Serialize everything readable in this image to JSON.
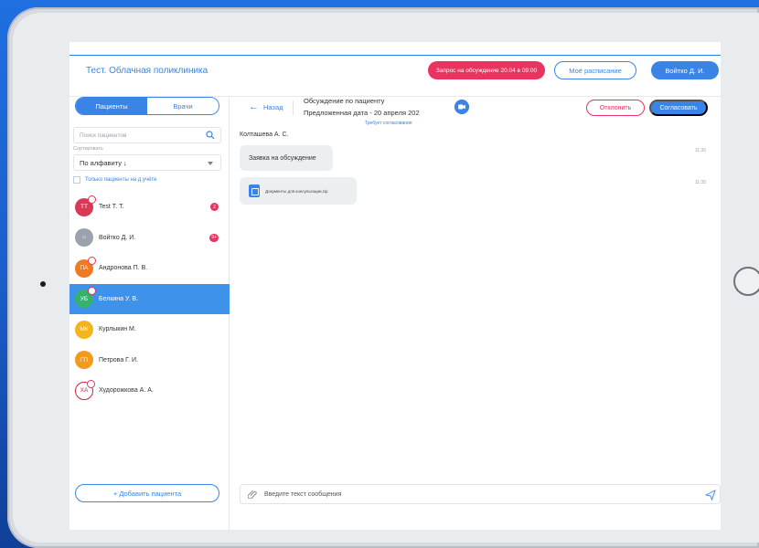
{
  "app": {
    "title": "Тест. Облачная поликлиника",
    "header": {
      "request_button": "Запрос на обсуждение 20.04 в 09:00",
      "schedule_button": "Моё расписание",
      "user_button": "Войтко Д. И."
    }
  },
  "sidebar": {
    "tabs": [
      "Пациенты",
      "Врачи"
    ],
    "search_placeholder": "Поиск пациентов",
    "sort_label": "Сортировать",
    "sort_value": "По алфавиту ↓",
    "only_mine_label": "Только пациенты на д.учёте",
    "patients": [
      {
        "initials": "ТТ",
        "name": "Test Т. Т.",
        "badge": "2",
        "color": "#d83a55"
      },
      {
        "initials": "",
        "name": "Войтко Д. И.",
        "badge": "9+",
        "color": "#9aa2ad"
      },
      {
        "initials": "ПА",
        "name": "Андронова П. В.",
        "badge": "",
        "color": "#f07a22"
      },
      {
        "initials": "УБ",
        "name": "Белкина У. В.",
        "badge": "",
        "color": "#33b36b"
      },
      {
        "initials": "МК",
        "name": "Курлыкин М.",
        "badge": "",
        "color": "#f5b41e"
      },
      {
        "initials": "ГП",
        "name": "Петрова Г. И.",
        "badge": "",
        "color": "#f39a1c"
      },
      {
        "initials": "ХА",
        "name": "Худорожкова А. А.",
        "badge": "",
        "color": "#c9283a"
      }
    ],
    "add_patient": "+ Добавить пациента"
  },
  "chat": {
    "back": "Назад",
    "topic": "Обсуждение по пациенту",
    "proposed_date": "Предложенная дата - 20 апреля 202",
    "needs_approval": "Требует согласования",
    "reject_button": "Отклонить",
    "accept_button": "Согласовать",
    "author": "Колташева А. С.",
    "messages": [
      {
        "text": "Заявка на обсуждение",
        "time": "11:35"
      },
      {
        "file": "Документы для консультации.zip",
        "time": "11:35"
      }
    ],
    "composer_placeholder": "Введите текст сообщения"
  }
}
